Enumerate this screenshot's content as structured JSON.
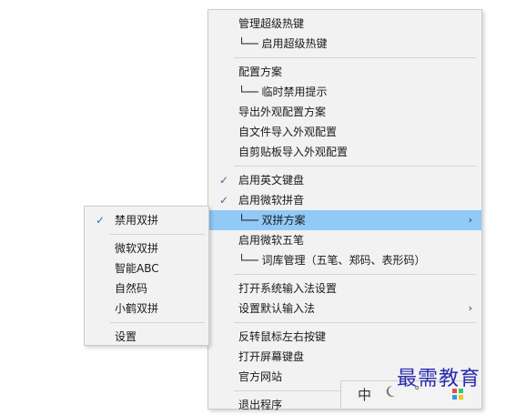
{
  "main_menu": {
    "items": [
      {
        "label": "管理超级热键"
      },
      {
        "label": "└── 启用超级热键"
      },
      {
        "label": "配置方案"
      },
      {
        "label": "└── 临时禁用提示"
      },
      {
        "label": "导出外观配置方案"
      },
      {
        "label": "自文件导入外观配置"
      },
      {
        "label": "自剪贴板导入外观配置"
      },
      {
        "label": "启用英文键盘",
        "checked": true
      },
      {
        "label": "启用微软拼音",
        "checked": true
      },
      {
        "label": "└── 双拼方案",
        "submenu": true,
        "highlighted": true
      },
      {
        "label": "启用微软五笔"
      },
      {
        "label": "└── 词库管理（五笔、郑码、表形码）"
      },
      {
        "label": "打开系统输入法设置"
      },
      {
        "label": "设置默认输入法",
        "submenu": true
      },
      {
        "label": "反转鼠标左右按键"
      },
      {
        "label": "打开屏幕键盘"
      },
      {
        "label": "官方网站"
      },
      {
        "label": "退出程序"
      }
    ],
    "check_glyph": "✓",
    "arrow_glyph": "›"
  },
  "sub_menu": {
    "items": [
      {
        "label": "禁用双拼",
        "checked": true
      },
      {
        "label": "微软双拼"
      },
      {
        "label": "智能ABC"
      },
      {
        "label": "自然码"
      },
      {
        "label": "小鹤双拼"
      },
      {
        "label": "设置"
      }
    ]
  },
  "taskbar": {
    "ime_label": "中",
    "moon_icon": "moon-icon",
    "settings_icon": "°",
    "grid_icon": "grid-icon"
  },
  "watermark": "最需教育",
  "colors": {
    "menu_bg": "#f2f2f2",
    "highlight": "#91c9f7",
    "check": "#3a6ea5",
    "watermark": "#2a2ab0"
  }
}
